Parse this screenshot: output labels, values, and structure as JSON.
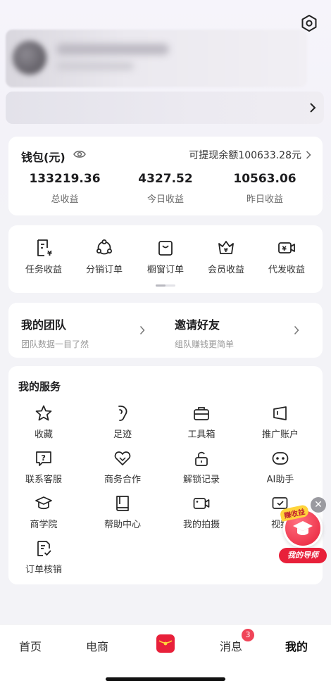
{
  "wallet": {
    "title": "钱包(元)",
    "withdrawable": "可提现余额100633.28元",
    "stats": [
      {
        "value": "133219.36",
        "label": "总收益"
      },
      {
        "value": "4327.52",
        "label": "今日收益"
      },
      {
        "value": "10563.06",
        "label": "昨日收益"
      }
    ]
  },
  "orders": [
    {
      "label": "任务收益",
      "icon": "task-income-icon"
    },
    {
      "label": "分销订单",
      "icon": "distribution-icon"
    },
    {
      "label": "橱窗订单",
      "icon": "showcase-bag-icon"
    },
    {
      "label": "会员收益",
      "icon": "member-crown-icon"
    },
    {
      "label": "代发收益",
      "icon": "video-money-icon"
    }
  ],
  "team": {
    "my_team": "我的团队",
    "my_team_sub": "团队数据一目了然",
    "invite": "邀请好友",
    "invite_sub": "组队赚钱更简单"
  },
  "services": {
    "title": "我的服务",
    "items": [
      {
        "label": "收藏",
        "icon": "star-icon"
      },
      {
        "label": "足迹",
        "icon": "footprint-icon"
      },
      {
        "label": "工具箱",
        "icon": "toolbox-icon"
      },
      {
        "label": "推广账户",
        "icon": "promo-account-icon"
      },
      {
        "label": "联系客服",
        "icon": "help-chat-icon"
      },
      {
        "label": "商务合作",
        "icon": "handshake-heart-icon"
      },
      {
        "label": "解锁记录",
        "icon": "unlock-icon"
      },
      {
        "label": "AI助手",
        "icon": "ai-face-icon"
      },
      {
        "label": "商学院",
        "icon": "graduation-cap-icon"
      },
      {
        "label": "帮助中心",
        "icon": "book-icon"
      },
      {
        "label": "我的拍摄",
        "icon": "camera-icon"
      },
      {
        "label": "视频",
        "icon": "video-icon"
      },
      {
        "label": "订单核销",
        "icon": "order-verify-icon"
      }
    ]
  },
  "floating": {
    "tag": "赚收益",
    "label": "我的导师"
  },
  "nav": {
    "home": "首页",
    "ecommerce": "电商",
    "messages": "消息",
    "messages_badge": "3",
    "mine": "我的"
  },
  "colors": {
    "accent": "#e8203a",
    "badge": "#f04458"
  }
}
